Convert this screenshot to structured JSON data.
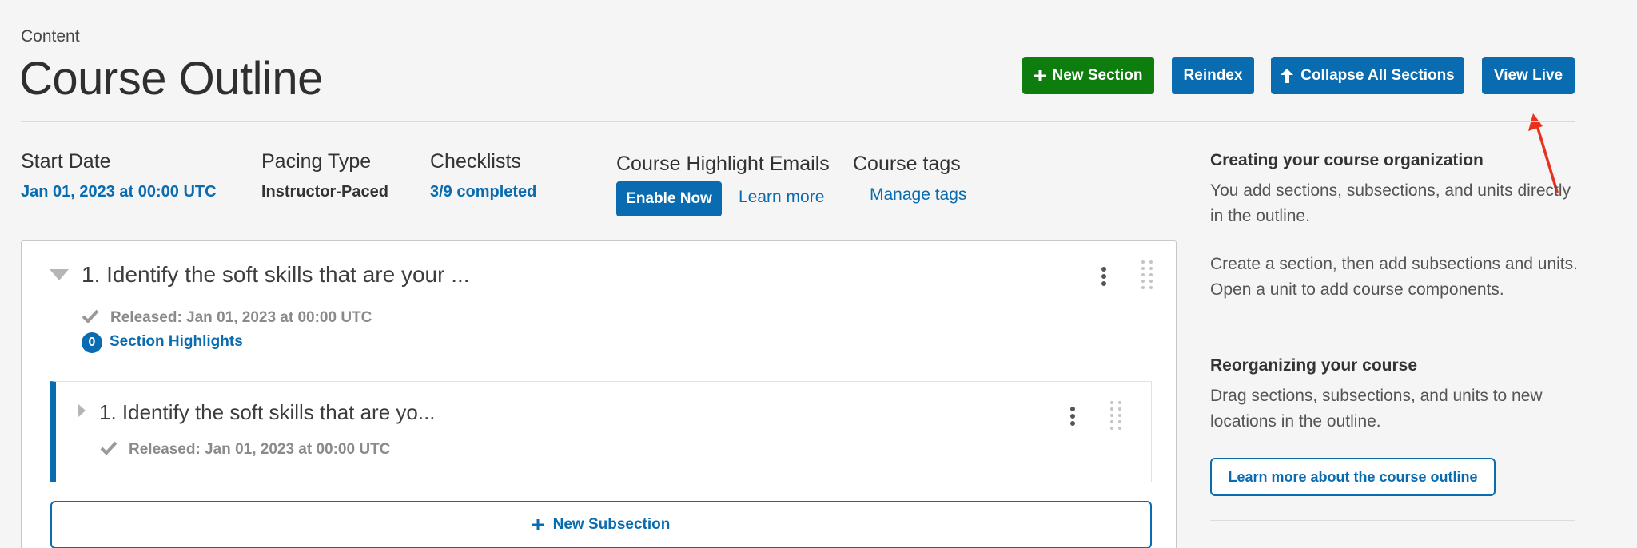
{
  "header": {
    "breadcrumb": "Content",
    "title": "Course Outline",
    "buttons": {
      "new_section": "New Section",
      "reindex": "Reindex",
      "collapse_all": "Collapse All Sections",
      "view_live": "View Live"
    }
  },
  "meta": {
    "start_date": {
      "label": "Start Date",
      "value": "Jan 01, 2023 at 00:00 UTC"
    },
    "pacing": {
      "label": "Pacing Type",
      "value": "Instructor-Paced"
    },
    "checklists": {
      "label": "Checklists",
      "value": "3/9 completed"
    },
    "highlight_emails": {
      "label": "Course Highlight Emails",
      "enable": "Enable Now",
      "learn_more": "Learn more"
    },
    "tags": {
      "label": "Course tags",
      "manage": "Manage tags"
    }
  },
  "section": {
    "title": "1. Identify the soft skills that are your ...",
    "released": "Released: Jan 01, 2023 at 00:00 UTC",
    "highlights_count": "0",
    "highlights_label": "Section Highlights",
    "subsection": {
      "title": "1. Identify the soft skills that are yo...",
      "released": "Released: Jan 01, 2023 at 00:00 UTC"
    },
    "new_subsection": "New Subsection"
  },
  "sidebar": {
    "org_heading": "Creating your course organization",
    "org_p1": "You add sections, subsections, and units directly in the outline.",
    "org_p2": "Create a section, then add subsections and units. Open a unit to add course components.",
    "reorg_heading": "Reorganizing your course",
    "reorg_p": "Drag sections, subsections, and units to new locations in the outline.",
    "learn_outline": "Learn more about the course outline"
  },
  "colors": {
    "primary": "#0a6cb0",
    "success": "#0d7d0d",
    "annotation_arrow": "#e8321e"
  },
  "icons": {
    "plus": "plus-icon",
    "arrow_up": "arrow-up-icon",
    "caret_down": "caret-down-icon",
    "caret_right": "caret-right-icon",
    "check": "check-icon",
    "kebab": "more-vertical-icon",
    "drag": "drag-handle-icon"
  }
}
